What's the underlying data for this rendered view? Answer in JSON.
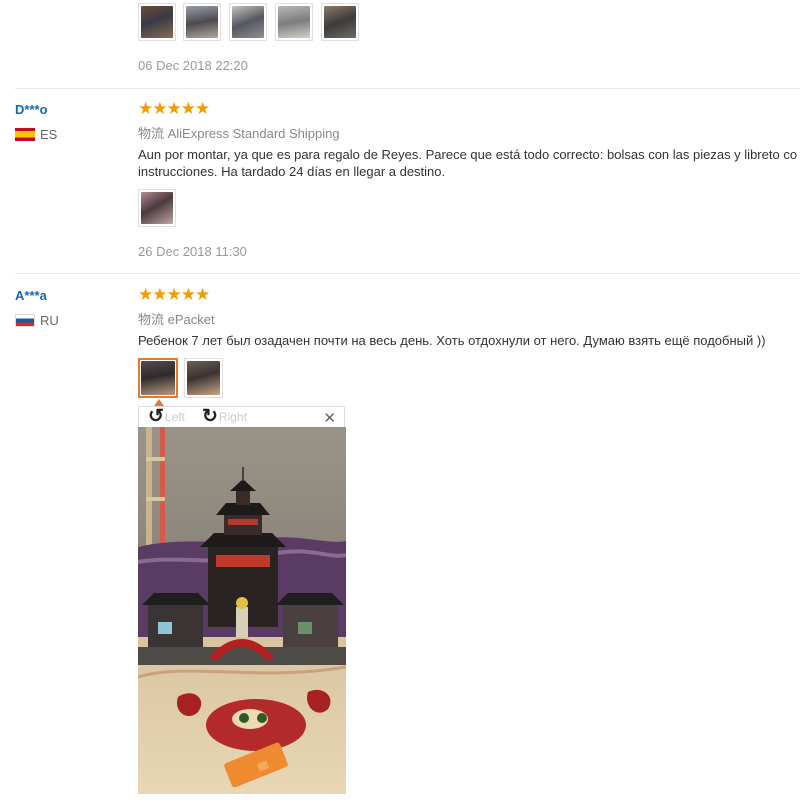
{
  "review_top": {
    "photo_count": 5,
    "date": "06 Dec 2018 22:20"
  },
  "review_es": {
    "user": "D***o",
    "country": "ES",
    "rating": 5,
    "stars": "★★★★★",
    "shipping": "物流 AliExpress Standard Shipping",
    "text_line1": "Aun por montar, ya que es para regalo de Reyes. Parece que está todo correcto: bolsas con las piezas y libreto co",
    "text_line2": "instrucciones. Ha tardado 24 días en llegar a destino.",
    "date": "26 Dec 2018 11:30"
  },
  "review_ru": {
    "user": "A***a",
    "country": "RU",
    "rating": 5,
    "stars": "★★★★★",
    "shipping": "物流 ePacket",
    "text": "Ребенок 7 лет был озадачен почти на весь день. Хоть отдохнули от него. Думаю взять ещё подобный ))"
  },
  "viewer": {
    "rotate_left_label": "Left",
    "rotate_right_label": "Right",
    "rotate_left_icon": "rotate-left-icon",
    "rotate_right_icon": "rotate-right-icon",
    "close_icon": "close-icon"
  },
  "colors": {
    "username": "#1469b8",
    "star": "#f39c00",
    "active_thumb_border": "#e8782d"
  }
}
